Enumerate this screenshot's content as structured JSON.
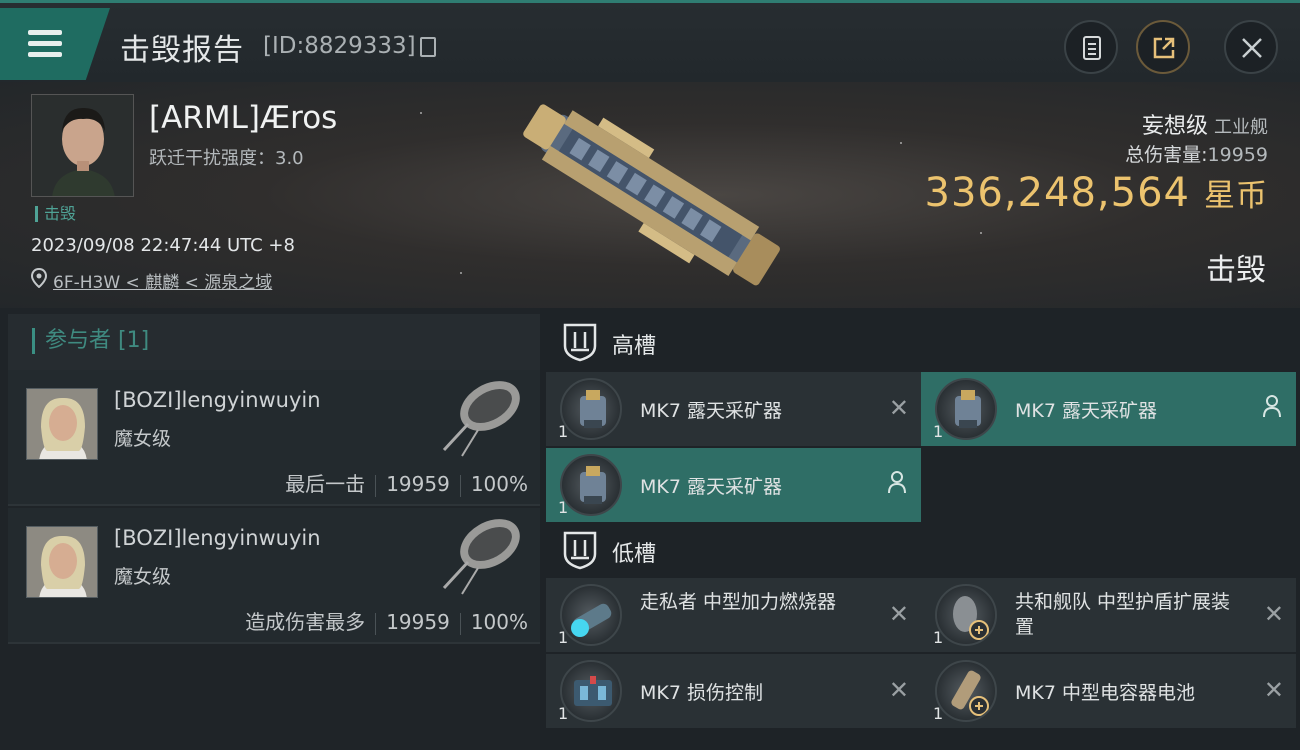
{
  "header": {
    "title": "击毁报告",
    "kill_id": "[ID:8829333]"
  },
  "victim": {
    "name": "[ARML]Æros",
    "warp_disruption": "跃迁干扰强度：3.0",
    "status_tag": "击毁",
    "datetime": "2023/09/08 22:47:44 UTC +8",
    "location": "6F-H3W < 麒麟 < 源泉之域",
    "ship_class": "妄想级",
    "ship_category": "工业舰",
    "total_damage_label": "总伤害量:",
    "total_damage": "19959",
    "isk_value": "336,248,564",
    "isk_unit": "星币",
    "result": "击毁"
  },
  "participants": {
    "header": "参与者 [1]",
    "attackers": [
      {
        "name": "[BOZI]lengyinwuyin",
        "ship": "魔女级",
        "role": "最后一击",
        "damage": "19959",
        "percent": "100%"
      },
      {
        "name": "[BOZI]lengyinwuyin",
        "ship": "魔女级",
        "role": "造成伤害最多",
        "damage": "19959",
        "percent": "100%"
      }
    ]
  },
  "fitting": {
    "high_slot_label": "高槽",
    "low_slot_label": "低槽",
    "high_modules": [
      {
        "name": "MK7 露天采矿器",
        "qty": "1",
        "state": "destroyed"
      },
      {
        "name": "MK7 露天采矿器",
        "qty": "1",
        "state": "dropped"
      },
      {
        "name": "MK7 露天采矿器",
        "qty": "1",
        "state": "dropped"
      }
    ],
    "low_modules": [
      {
        "name": "走私者 中型加力燃烧器",
        "qty": "1",
        "state": "destroyed"
      },
      {
        "name": "共和舰队 中型护盾扩展装置",
        "qty": "1",
        "state": "destroyed"
      },
      {
        "name": "MK7 损伤控制",
        "qty": "1",
        "state": "destroyed"
      },
      {
        "name": "MK7 中型电容器电池",
        "qty": "1",
        "state": "destroyed"
      }
    ]
  },
  "colors": {
    "accent": "#2f6e66",
    "isk": "#ecc36e",
    "teal_text": "#4fa396"
  },
  "icons": [
    "menu-icon",
    "copy-icon",
    "clipboard-icon",
    "share-icon",
    "close-icon",
    "location-pin-icon",
    "slot-shield-icon",
    "user-icon",
    "destroyed-x-icon"
  ]
}
